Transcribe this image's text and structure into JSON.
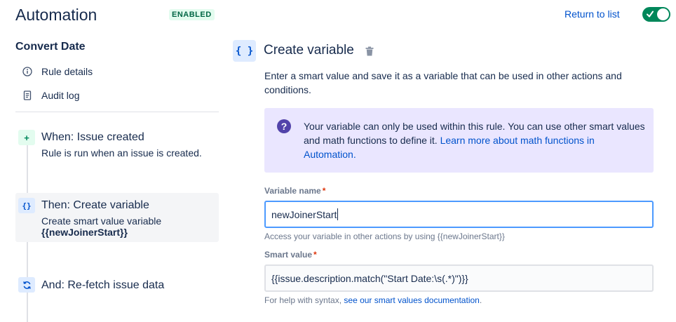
{
  "header": {
    "title": "Automation",
    "status_badge": "ENABLED",
    "return_link": "Return to list",
    "toggle_enabled": true
  },
  "sidebar": {
    "rule_name": "Convert Date",
    "links": [
      {
        "label": "Rule details",
        "icon": "info-icon"
      },
      {
        "label": "Audit log",
        "icon": "document-icon"
      }
    ],
    "steps": [
      {
        "title": "When: Issue created",
        "subtitle": "Rule is run when an issue is created.",
        "icon": "plus-icon"
      },
      {
        "title": "Then: Create variable",
        "subtitle": "Create smart value variable",
        "subtitle_bold": "{{newJoinerStart}}",
        "icon": "braces-icon",
        "active": true
      },
      {
        "title": "And: Re-fetch issue data",
        "icon": "refresh-icon"
      }
    ]
  },
  "pane": {
    "icon_glyph": "{ }",
    "title": "Create variable",
    "description": "Enter a smart value and save it as a variable that can be used in other actions and conditions.",
    "info": {
      "text": "Your variable can only be used within this rule. You can use other smart values and math functions to define it. ",
      "link": "Learn more about math functions in Automation."
    },
    "variable_name": {
      "label": "Variable name",
      "required_mark": "*",
      "value": "newJoinerStart",
      "helper": "Access your variable in other actions by using {{newJoinerStart}}"
    },
    "smart_value": {
      "label": "Smart value",
      "required_mark": "*",
      "value": "{{issue.description.match(\"Start Date:\\s(.*)\")}}",
      "helper_prefix": "For help with syntax, ",
      "helper_link": "see our smart values documentation",
      "helper_suffix": "."
    }
  },
  "colors": {
    "accent": "#0052cc",
    "toggle_on": "#00875a",
    "info_bg": "#eae6ff",
    "info_icon": "#5243aa",
    "badge_bg": "#e3fcef",
    "badge_text": "#006644",
    "required": "#de350b"
  }
}
